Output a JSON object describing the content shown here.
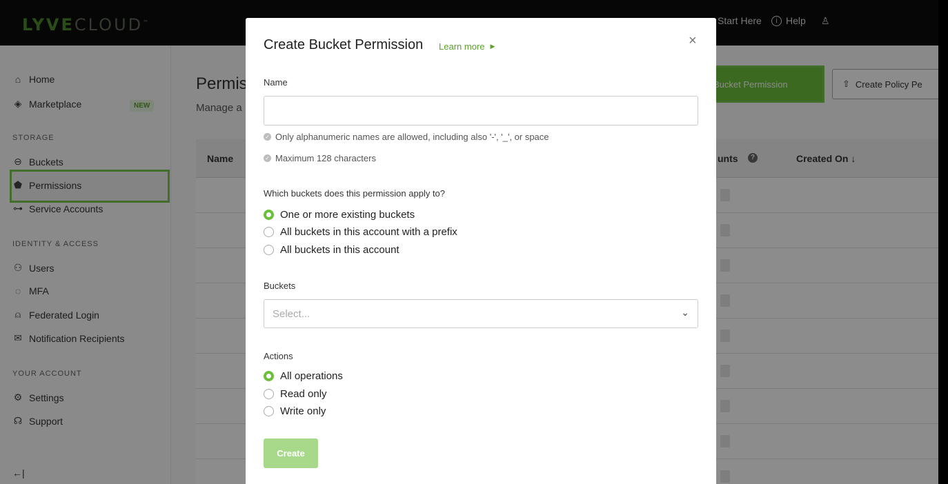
{
  "app": {
    "logo_bold": "LYVE",
    "logo_thin": "CLOUD",
    "logo_tm": "™"
  },
  "topnav": {
    "start_here": "Start Here",
    "help": "Help",
    "help_icon": "info-circle-icon",
    "user_icon": "user-icon"
  },
  "sidebar": {
    "home": "Home",
    "marketplace": "Marketplace",
    "marketplace_badge": "NEW",
    "section_storage": "STORAGE",
    "buckets": "Buckets",
    "permissions": "Permissions",
    "service_accounts": "Service Accounts",
    "section_identity": "IDENTITY & ACCESS",
    "users": "Users",
    "mfa": "MFA",
    "federated_login": "Federated Login",
    "notification_recipients": "Notification Recipients",
    "section_account": "YOUR ACCOUNT",
    "settings": "Settings",
    "support": "Support",
    "collapse": "←|"
  },
  "main": {
    "title": "Permis",
    "subtitle": "Manage a",
    "col_name": "Name",
    "col_accounts": "unts",
    "col_created": "Created On ↓",
    "create_bucket_btn": "Bucket Permission",
    "create_policy_btn": "Create Policy Pe",
    "create_policy_icon": "upload-icon"
  },
  "modal": {
    "title": "Create Bucket Permission",
    "learn_more": "Learn more",
    "close": "×",
    "name_label": "Name",
    "name_value": "",
    "hint1": "Only alphanumeric names are allowed, including also '-', '_', or space",
    "hint2": "Maximum 128 characters",
    "apply_label": "Which buckets does this permission apply to?",
    "apply_options": [
      "One or more existing buckets",
      "All buckets in this account with a prefix",
      "All buckets in this account"
    ],
    "apply_selected": "One or more existing buckets",
    "buckets_label": "Buckets",
    "buckets_placeholder": "Select...",
    "actions_label": "Actions",
    "action_options": [
      "All operations",
      "Read only",
      "Write only"
    ],
    "action_selected": "All operations",
    "create_button": "Create"
  },
  "colors": {
    "accent": "#6cbf3a",
    "highlight": "#7bc74d"
  }
}
